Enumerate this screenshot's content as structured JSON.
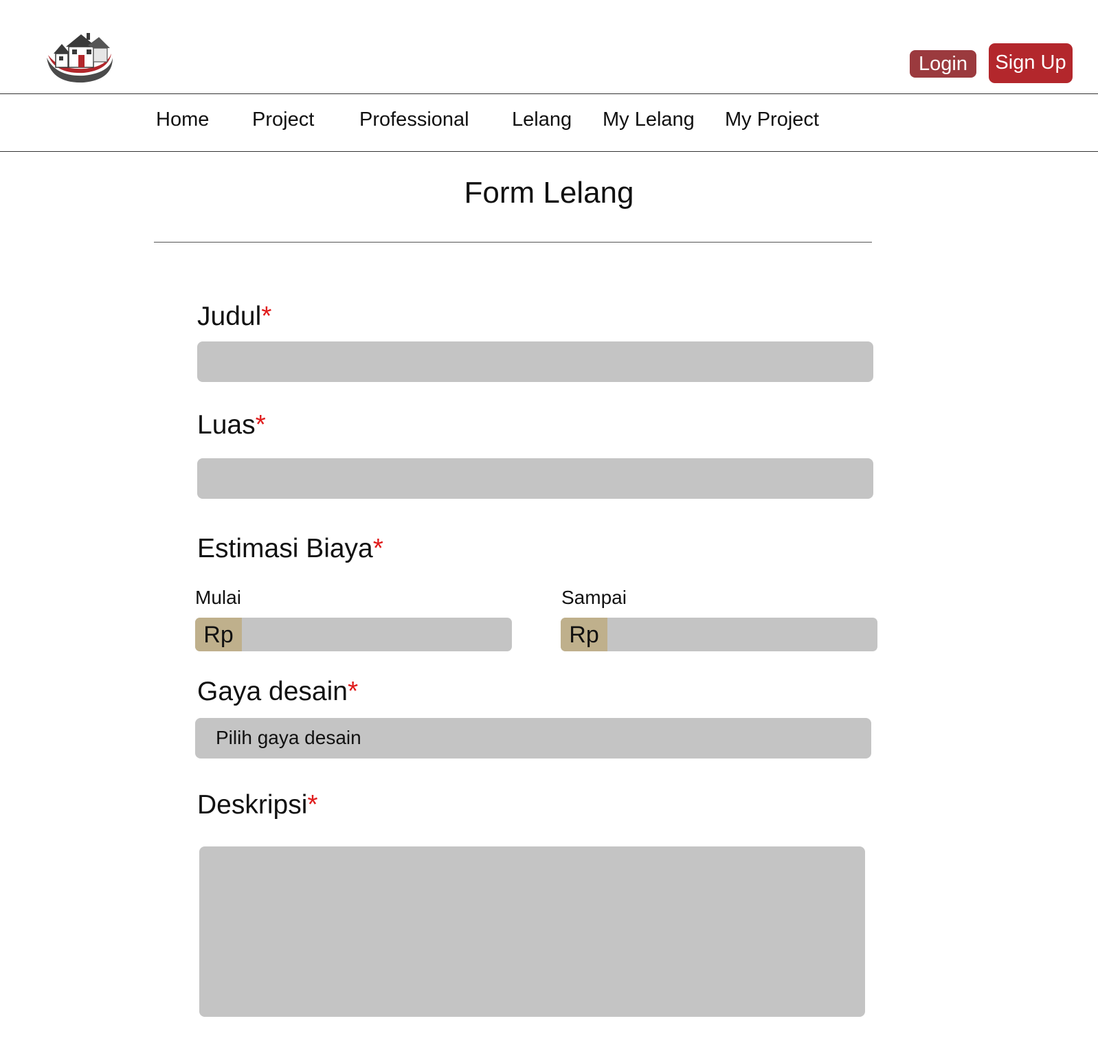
{
  "header": {
    "login_label": "Login",
    "signup_label": "Sign Up"
  },
  "nav": {
    "items": [
      {
        "label": "Home"
      },
      {
        "label": "Project"
      },
      {
        "label": "Professional"
      },
      {
        "label": "Lelang"
      },
      {
        "label": "My Lelang"
      },
      {
        "label": "My Project"
      }
    ]
  },
  "page_title": "Form Lelang",
  "form": {
    "required_marker": "*",
    "judul": {
      "label": "Judul",
      "value": ""
    },
    "luas": {
      "label": "Luas",
      "value": ""
    },
    "estimasi_biaya": {
      "label": "Estimasi Biaya",
      "mulai": {
        "label": "Mulai",
        "prefix": "Rp",
        "value": ""
      },
      "sampai": {
        "label": "Sampai",
        "prefix": "Rp",
        "value": ""
      }
    },
    "gaya_desain": {
      "label": "Gaya desain",
      "selected": "Pilih gaya desain"
    },
    "deskripsi": {
      "label": "Deskripsi",
      "value": ""
    }
  },
  "colors": {
    "login_button": "#9b3a3e",
    "signup_button": "#b3272c",
    "required": "#e01b1b",
    "input_background": "#c4c4c4",
    "currency_prefix": "#bfb08c"
  },
  "icons": {
    "logo": "house-logo-icon"
  }
}
